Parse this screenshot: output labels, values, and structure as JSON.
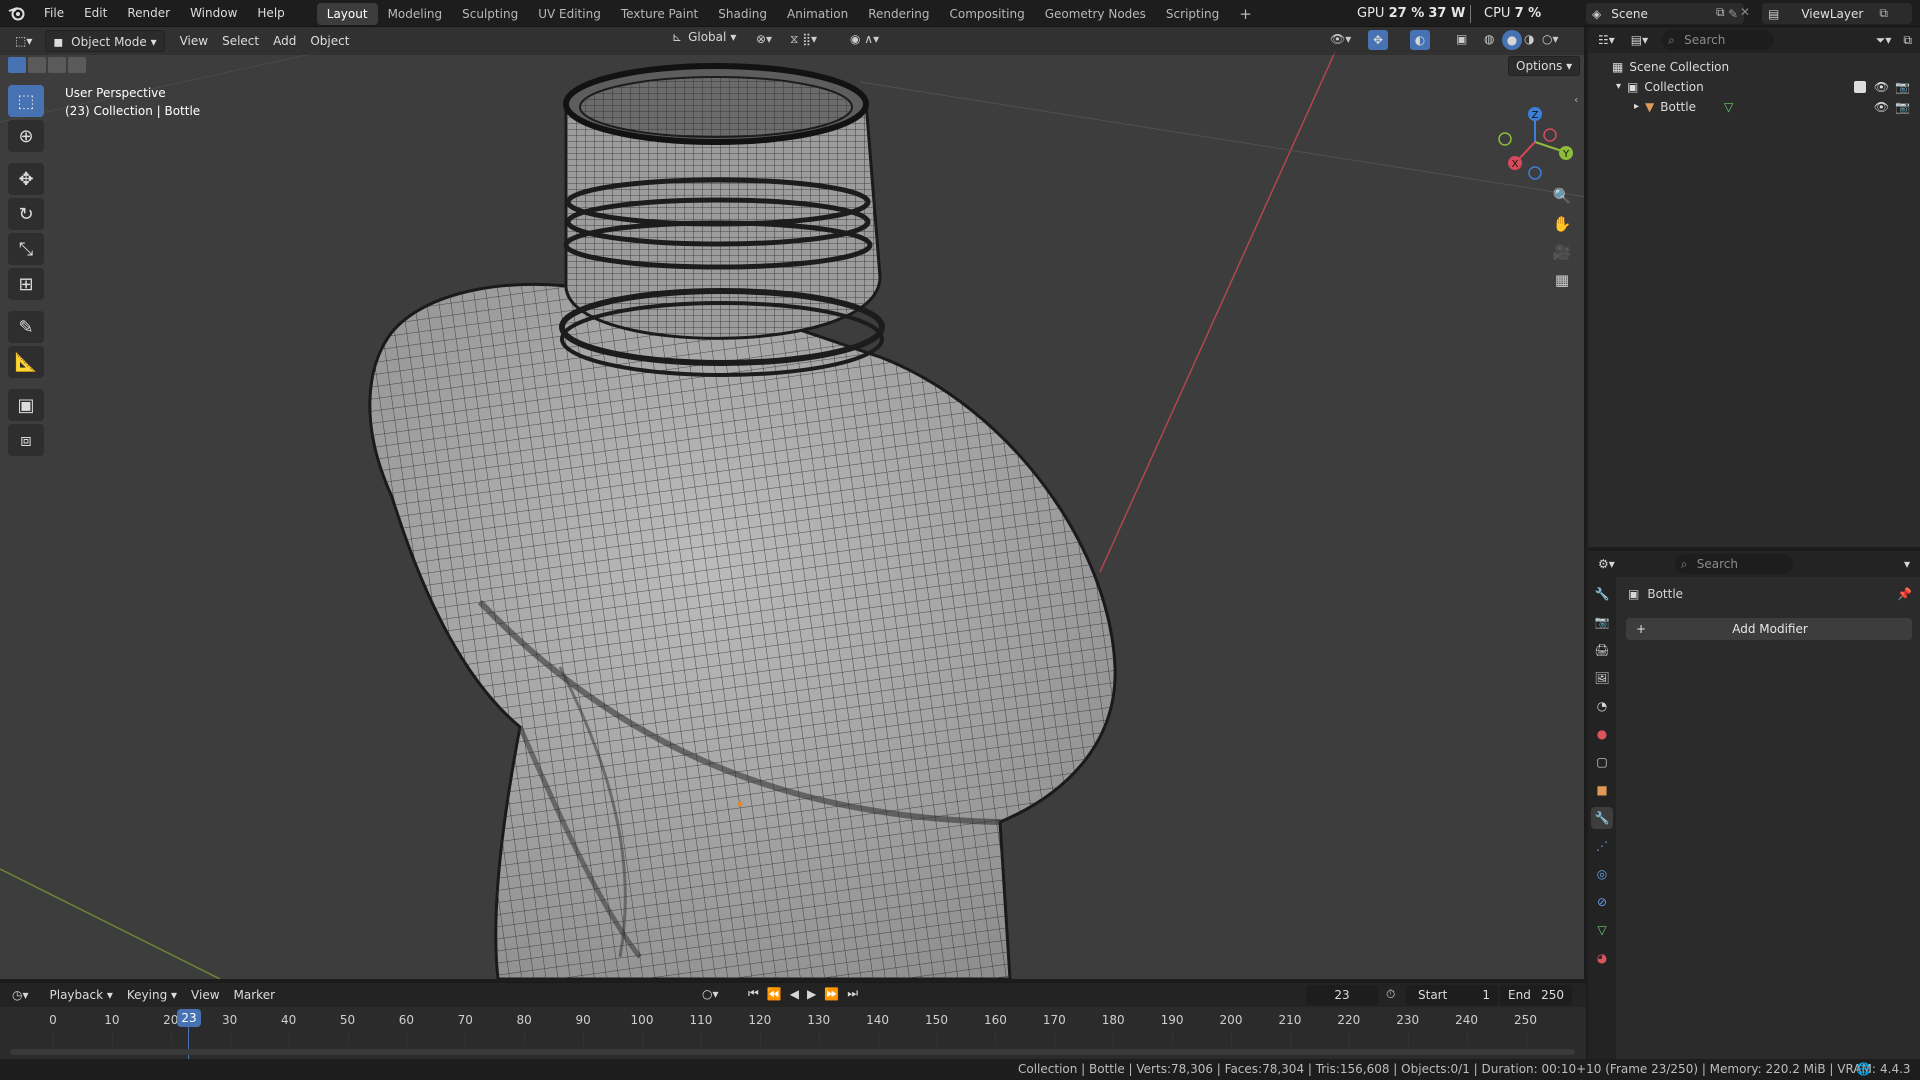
{
  "topbar": {
    "menus": [
      "File",
      "Edit",
      "Render",
      "Window",
      "Help"
    ],
    "workspaces": [
      "Layout",
      "Modeling",
      "Sculpting",
      "UV Editing",
      "Texture Paint",
      "Shading",
      "Animation",
      "Rendering",
      "Compositing",
      "Geometry Nodes",
      "Scripting"
    ],
    "active_workspace": "Layout",
    "add_workspace": "+",
    "gpu_label": "GPU",
    "gpu_value": "27 %",
    "gpu_watts": "37 W",
    "cpu_label": "CPU",
    "cpu_value": "7 %",
    "scene_name": "Scene",
    "view_layer": "ViewLayer"
  },
  "viewport": {
    "mode": "Object Mode",
    "menus": [
      "View",
      "Select",
      "Add",
      "Object"
    ],
    "transform_orientation": "Global",
    "options_label": "Options",
    "overlay_title": "User Perspective",
    "overlay_subtitle": "(23) Collection | Bottle",
    "gizmo_axes": {
      "x": "X",
      "y": "Y",
      "z": "Z"
    },
    "colors": {
      "x_axis": "#d84a5b",
      "y_axis": "#8cbc3a",
      "z_axis": "#3c7fd8",
      "active_tool": "#4772b3"
    }
  },
  "outliner": {
    "search_placeholder": "Search",
    "scene_collection": "Scene Collection",
    "collection": "Collection",
    "object": "Bottle"
  },
  "properties": {
    "search_placeholder": "Search",
    "object_name": "Bottle",
    "add_modifier": "Add Modifier",
    "add_modifier_icon": "+"
  },
  "timeline": {
    "menus": [
      "Playback",
      "Keying",
      "View",
      "Marker"
    ],
    "current_frame": "23",
    "start_label": "Start",
    "start_value": "1",
    "end_label": "End",
    "end_value": "250",
    "ticks": [
      "0",
      "10",
      "20",
      "30",
      "40",
      "50",
      "60",
      "70",
      "80",
      "90",
      "100",
      "110",
      "120",
      "130",
      "140",
      "150",
      "160",
      "170",
      "180",
      "190",
      "200",
      "210",
      "220",
      "230",
      "240",
      "250"
    ]
  },
  "statusbar": {
    "text": "Collection | Bottle | Verts:78,306 | Faces:78,304 | Tris:156,608 | Objects:0/1 | Duration: 00:10+10 (Frame 23/250) | Memory: 220.2 MiB | VRAM: 1.0/4.0 GiB |",
    "version": "4.4.3"
  }
}
